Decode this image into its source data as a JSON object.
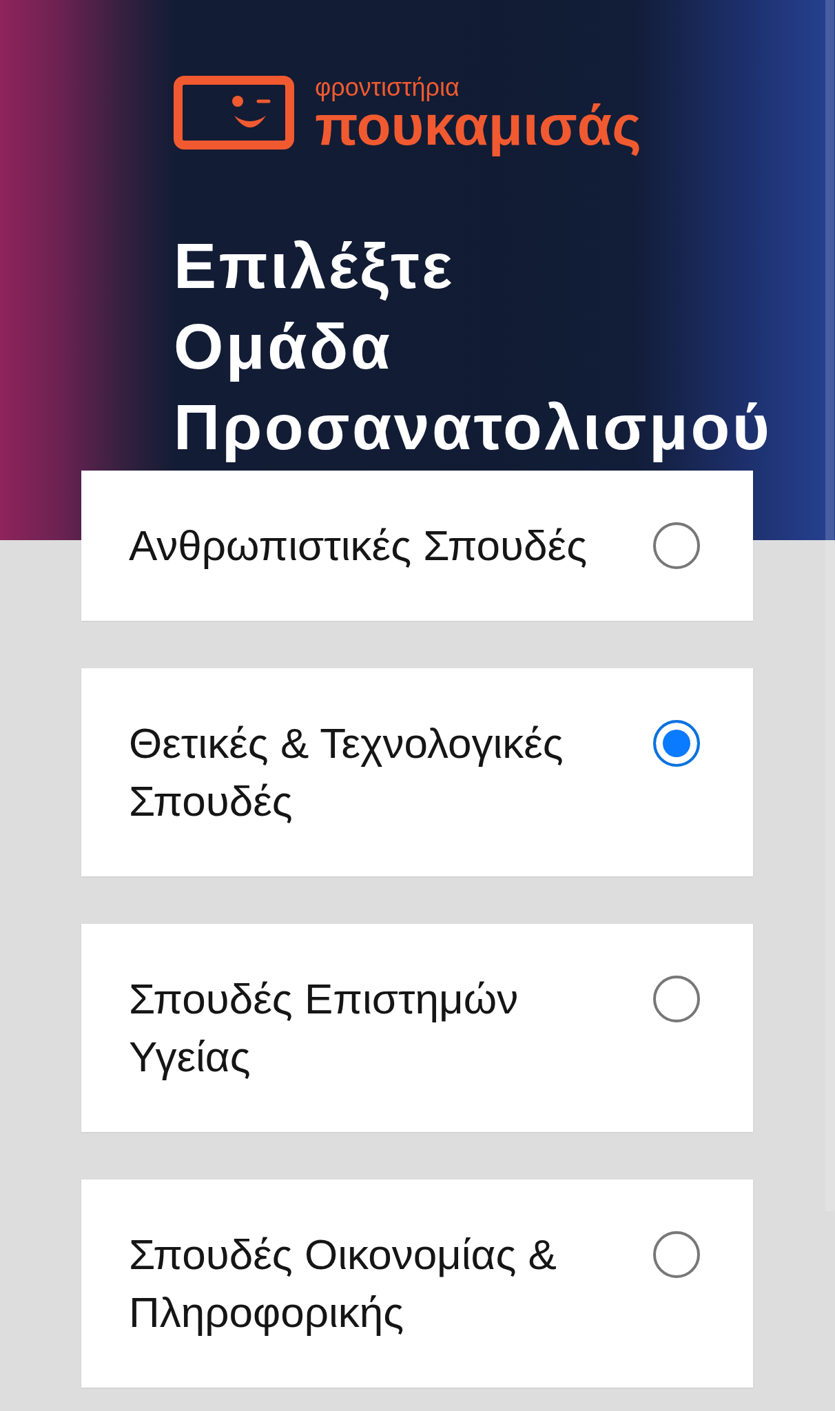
{
  "logo": {
    "tagline": "φροντιστήρια",
    "name": "πουκαμισάς"
  },
  "title_lines": [
    "Επιλέξτε",
    "Ομάδα",
    "Προσανατολισμού"
  ],
  "options": [
    {
      "label": "Ανθρωπιστικές Σπουδές",
      "selected": false
    },
    {
      "label": "Θετικές & Τεχνολογικές Σπουδές",
      "selected": true
    },
    {
      "label": "Σπουδές Επιστημών Υγείας",
      "selected": false
    },
    {
      "label": "Σπουδές Οικονομίας & Πληροφορικής",
      "selected": false
    }
  ]
}
